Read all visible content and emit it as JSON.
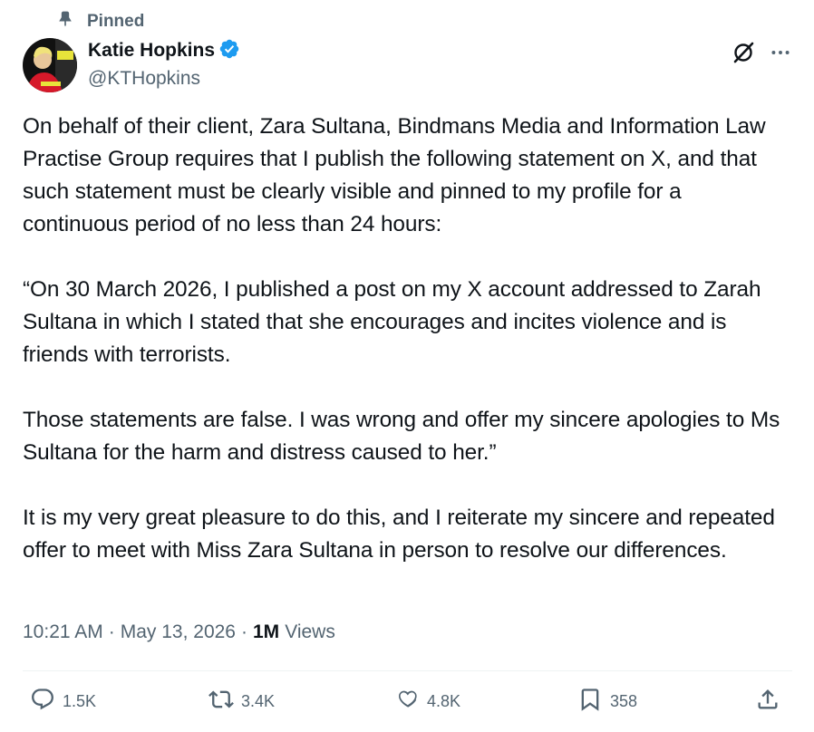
{
  "pinned": {
    "label": "Pinned"
  },
  "author": {
    "display_name": "Katie Hopkins",
    "handle": "@KTHopkins",
    "verified": true
  },
  "tweet": {
    "paragraphs": [
      "On behalf of their client, Zara Sultana, Bindmans Media and Information Law Practise Group requires that I publish the following statement on X, and that such statement must be clearly visible and pinned to my profile for a continuous period of no less than 24 hours:",
      "“On 30 March 2026, I published a post on my X account addressed to Zarah Sultana in which I stated that she encourages and incites violence and is friends with terrorists.",
      "Those statements are false. I was wrong and offer my sincere apologies to Ms Sultana for the harm and distress caused to her.”",
      "It is my very great pleasure to do this, and I reiterate my sincere and repeated offer to meet with Miss Zara Sultana in person to resolve our differences."
    ]
  },
  "meta": {
    "time": "10:21 AM",
    "date": "May 13, 2026",
    "separator": "·",
    "views_count": "1M",
    "views_label": "Views"
  },
  "actions": {
    "replies": "1.5K",
    "reposts": "3.4K",
    "likes": "4.8K",
    "bookmarks": "358"
  },
  "icons": {
    "pin": "pin-icon",
    "verified": "verified-badge-icon",
    "grok": "grok-icon",
    "more": "more-horizontal-icon",
    "reply": "reply-icon",
    "repost": "repost-icon",
    "like": "heart-icon",
    "bookmark": "bookmark-icon",
    "share": "share-icon"
  },
  "colors": {
    "text_primary": "#0f1419",
    "text_secondary": "#536471",
    "verified_blue": "#1d9bf0",
    "divider": "#eff3f4"
  }
}
